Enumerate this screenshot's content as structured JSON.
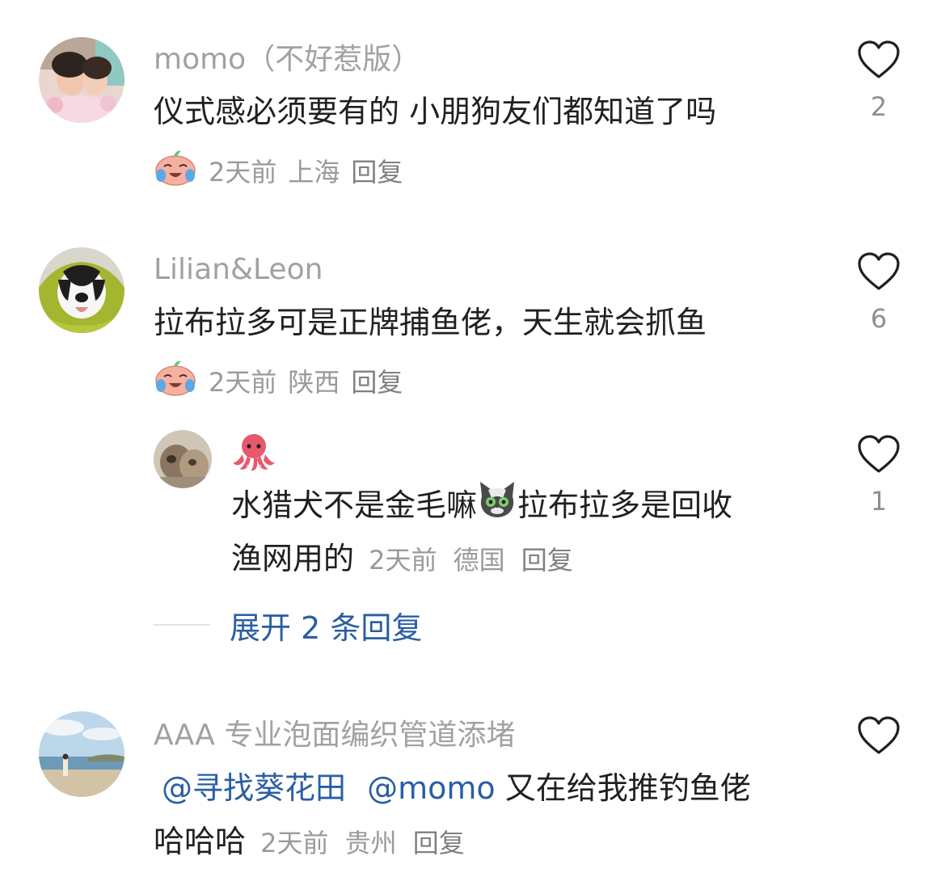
{
  "comments": [
    {
      "username": "momo（不好惹版）",
      "text": "仪式感必须要有的 小朋狗友们都知道了吗",
      "time": "2天前",
      "location": "上海",
      "reply": "回复",
      "likes": "2",
      "emoji": "crying-laughing-face-icon"
    },
    {
      "username": "Lilian&Leon",
      "text": "拉布拉多可是正牌捕鱼佬，天生就会抓鱼",
      "time": "2天前",
      "location": "陕西",
      "reply": "回复",
      "likes": "6",
      "emoji": "crying-laughing-face-icon"
    },
    {
      "username": "AAA 专业泡面编织管道添堵",
      "mention1": "@寻找葵花田",
      "mention2": "@momo",
      "text_after": " 又在给我推钓鱼佬",
      "text_line2": "哈哈哈",
      "time": "2天前",
      "location": "贵州",
      "reply": "回复",
      "likes": ""
    }
  ],
  "nested_reply": {
    "username_emoji": "octopus-icon",
    "text_line1_a": "水猎犬不是金毛嘛",
    "text_line1_b": "拉布拉多是回收",
    "text_line2": "渔网用的",
    "time": "2天前",
    "location": "德国",
    "reply": "回复",
    "likes": "1",
    "inline_emoji": "cat-face-icon"
  },
  "expand_replies": "展开 2 条回复",
  "colors": {
    "link": "#2a5ea3",
    "meta": "#9a9a9a",
    "username": "#a1a1a1",
    "text": "#202020"
  }
}
